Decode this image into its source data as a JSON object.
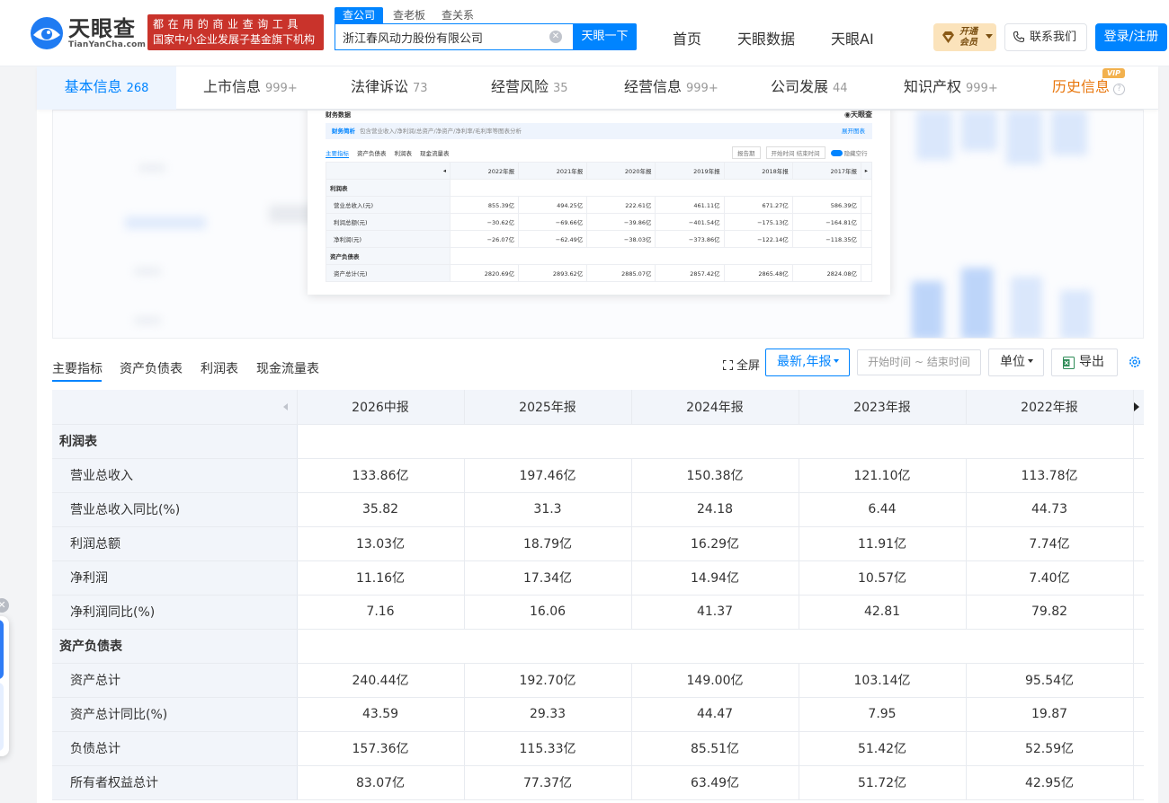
{
  "brand": {
    "name_cn": "天眼查",
    "name_en": "TianYanCha.com",
    "slogan_line1": "都在用的商业查询工具",
    "slogan_line2": "国家中小企业发展子基金旗下机构"
  },
  "search": {
    "tabs": [
      "查公司",
      "查老板",
      "查关系"
    ],
    "value": "浙江春风动力股份有限公司",
    "button": "天眼一下"
  },
  "nav": {
    "items": [
      "首页",
      "天眼数据",
      "天眼AI"
    ],
    "vip_line1": "开通",
    "vip_line2": "会员",
    "contact": "联系我们",
    "login": "登录/注册"
  },
  "tabs": [
    {
      "label": "基本信息",
      "count": "268"
    },
    {
      "label": "上市信息",
      "count": "999+"
    },
    {
      "label": "法律诉讼",
      "count": "73"
    },
    {
      "label": "经营风险",
      "count": "35"
    },
    {
      "label": "经营信息",
      "count": "999+"
    },
    {
      "label": "公司发展",
      "count": "44"
    },
    {
      "label": "知识产权",
      "count": "999+"
    },
    {
      "label": "历史信息",
      "count": ""
    }
  ],
  "vip_tag": "VIP",
  "preview": {
    "title": "财务数据",
    "logo": "天眼查",
    "banner_title": "财务简析",
    "banner_desc": "包含营业收入/净利润/总资产/净资产/净利率/毛利率等图表分析",
    "banner_more": "展开图表",
    "tabs": [
      "主要指标",
      "资产负债表",
      "利润表",
      "现金流量表"
    ],
    "ctrl_period": "报告期",
    "ctrl_start": "开始时间",
    "ctrl_end": "结束时间",
    "ctrl_toggle": "隐藏空行",
    "years": [
      "2022年报",
      "2021年报",
      "2020年报",
      "2019年报",
      "2018年报",
      "2017年报"
    ],
    "section1": "利润表",
    "section2": "资产负债表",
    "rows": [
      {
        "label": "营业总收入(元)",
        "values": [
          "855.39亿",
          "494.25亿",
          "222.61亿",
          "461.11亿",
          "671.27亿",
          "586.39亿"
        ]
      },
      {
        "label": "利润总额(元)",
        "values": [
          "−30.62亿",
          "−69.66亿",
          "−39.86亿",
          "−401.54亿",
          "−175.13亿",
          "−164.81亿"
        ]
      },
      {
        "label": "净利润(元)",
        "values": [
          "−26.07亿",
          "−62.49亿",
          "−38.03亿",
          "−373.86亿",
          "−122.14亿",
          "−118.35亿"
        ]
      }
    ],
    "last_row": {
      "label": "资产总计(元)",
      "values": [
        "2820.69亿",
        "2893.62亿",
        "2885.07亿",
        "2857.42亿",
        "2865.48亿",
        "2824.08亿"
      ]
    }
  },
  "subtabs": [
    "主要指标",
    "资产负债表",
    "利润表",
    "现金流量表"
  ],
  "controls": {
    "fullscreen": "全屏",
    "period": "最新,年报",
    "date_range": "开始时间 ~ 结束时间",
    "unit": "单位",
    "export": "导出"
  },
  "table": {
    "columns": [
      "2026中报",
      "2025年报",
      "2024年报",
      "2023年报",
      "2022年报"
    ],
    "sections": [
      {
        "title": "利润表",
        "rows": [
          {
            "label": "营业总收入",
            "values": [
              "133.86亿",
              "197.46亿",
              "150.38亿",
              "121.10亿",
              "113.78亿"
            ]
          },
          {
            "label": "营业总收入同比(%)",
            "values": [
              "35.82",
              "31.3",
              "24.18",
              "6.44",
              "44.73"
            ]
          },
          {
            "label": "利润总额",
            "values": [
              "13.03亿",
              "18.79亿",
              "16.29亿",
              "11.91亿",
              "7.74亿"
            ]
          },
          {
            "label": "净利润",
            "values": [
              "11.16亿",
              "17.34亿",
              "14.94亿",
              "10.57亿",
              "7.40亿"
            ]
          },
          {
            "label": "净利润同比(%)",
            "values": [
              "7.16",
              "16.06",
              "41.37",
              "42.81",
              "79.82"
            ]
          }
        ]
      },
      {
        "title": "资产负债表",
        "rows": [
          {
            "label": "资产总计",
            "values": [
              "240.44亿",
              "192.70亿",
              "149.00亿",
              "103.14亿",
              "95.54亿"
            ]
          },
          {
            "label": "资产总计同比(%)",
            "values": [
              "43.59",
              "29.33",
              "44.47",
              "7.95",
              "19.87"
            ]
          },
          {
            "label": "负债总计",
            "values": [
              "157.36亿",
              "115.33亿",
              "85.51亿",
              "51.42亿",
              "52.59亿"
            ]
          },
          {
            "label": "所有者权益总计",
            "values": [
              "83.07亿",
              "77.37亿",
              "63.49亿",
              "51.72亿",
              "42.95亿"
            ]
          }
        ]
      }
    ]
  },
  "colors": {
    "accent": "#0084ff",
    "brand_red": "#c9332b",
    "history": "#e8760c"
  }
}
